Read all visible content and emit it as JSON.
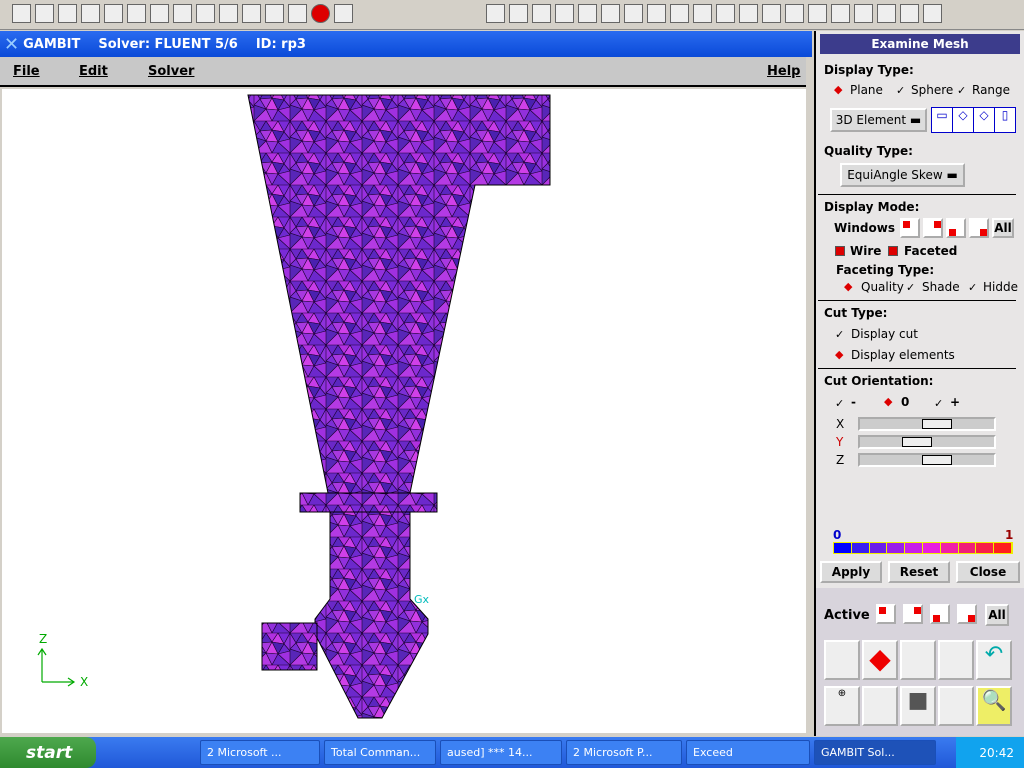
{
  "window": {
    "app": "GAMBIT",
    "solver": "Solver: FLUENT 5/6",
    "id": "ID: rp3"
  },
  "menu": {
    "file": "File",
    "edit": "Edit",
    "solver": "Solver",
    "help": "Help"
  },
  "viewport": {
    "axis_z": "Z",
    "axis_x": "X",
    "node_label": "Gx",
    "mesh_color": "#8a2be2"
  },
  "panel": {
    "title": "Examine Mesh",
    "display_type_label": "Display Type:",
    "display_types": [
      "Plane",
      "Sphere",
      "Range"
    ],
    "display_type_selected": "Plane",
    "element_dropdown": "3D Element",
    "quality_type_label": "Quality Type:",
    "quality_dropdown": "EquiAngle Skew",
    "display_mode_label": "Display Mode:",
    "windows_label": "Windows",
    "all_label": "All",
    "wire_label": "Wire",
    "wire_checked": true,
    "faceted_label": "Faceted",
    "faceted_checked": true,
    "faceting_type_label": "Faceting Type:",
    "faceting_types": [
      "Quality",
      "Shade",
      "Hidde"
    ],
    "faceting_selected": "Quality",
    "cut_type_label": "Cut Type:",
    "cut_types": [
      "Display cut",
      "Display elements"
    ],
    "cut_selected": "Display elements",
    "cut_orientation_label": "Cut Orientation:",
    "orientations": [
      "-",
      "0",
      "+"
    ],
    "orientation_selected": "0",
    "sliders": [
      {
        "axis": "X",
        "value": 0.6
      },
      {
        "axis": "Y",
        "value": 0.4
      },
      {
        "axis": "Z",
        "value": 0.6
      }
    ],
    "scale_min": "0",
    "scale_max": "1",
    "scale_colors": [
      "#0000ff",
      "#3a1ef0",
      "#6a1ee8",
      "#9a1ee8",
      "#c81ee8",
      "#e81ee0",
      "#f01ea8",
      "#f01e78",
      "#f81e48",
      "#ff1e1e"
    ],
    "apply": "Apply",
    "reset": "Reset",
    "close": "Close"
  },
  "global_control": {
    "active_label": "Active",
    "all_label": "All"
  },
  "taskbar": {
    "start": "start",
    "tasks": [
      "2 Microsoft ...",
      "Total Comman...",
      "aused] *** 14...",
      "2 Microsoft P...",
      "Exceed",
      "GAMBIT    Sol..."
    ],
    "clock": "20:42"
  }
}
